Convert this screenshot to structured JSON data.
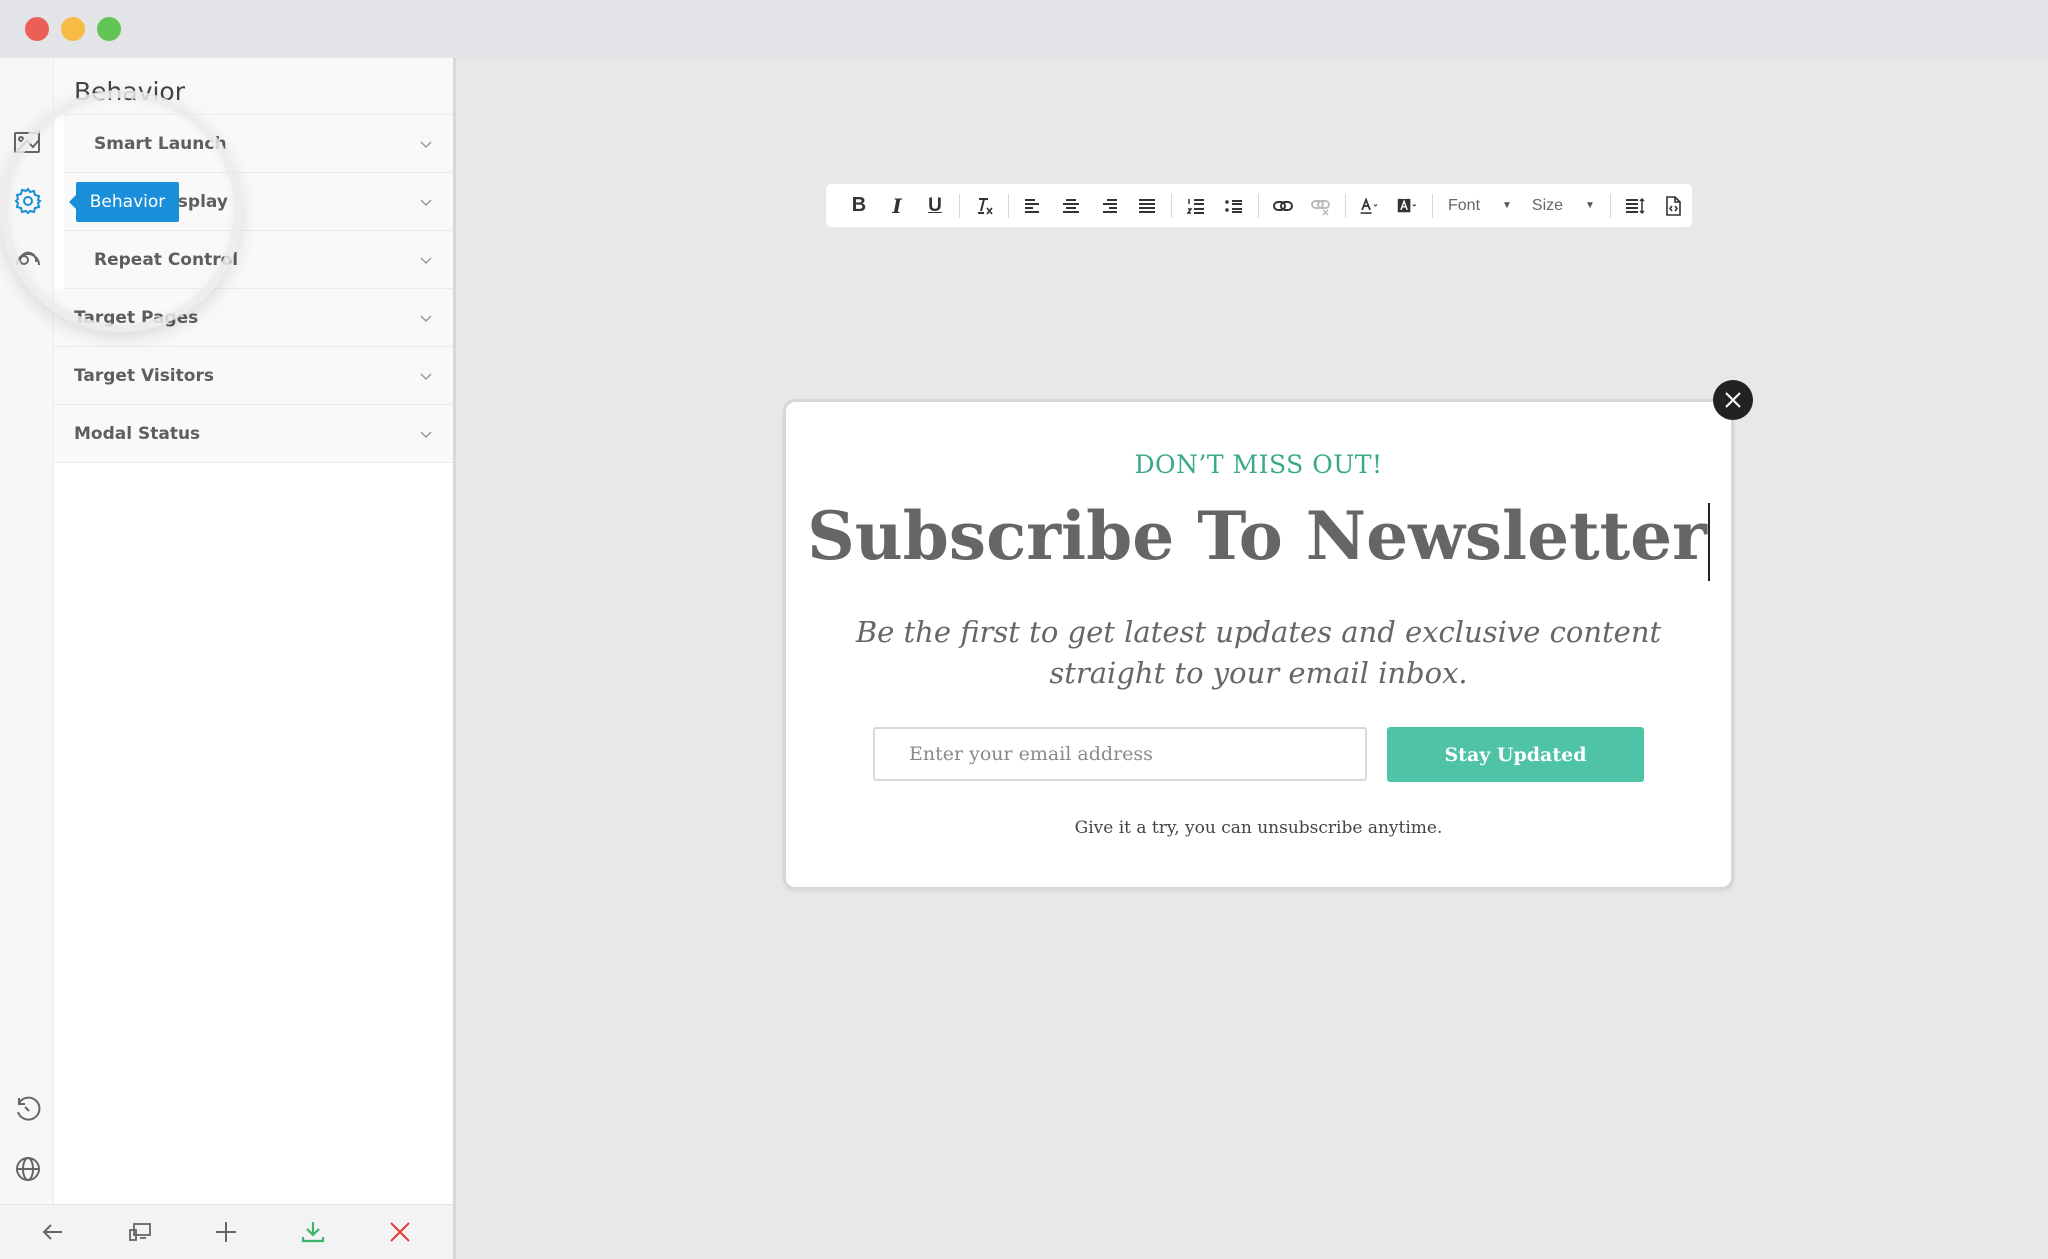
{
  "window": {
    "controls": [
      "close",
      "minimize",
      "maximize"
    ]
  },
  "rail": {
    "items": [
      {
        "icon": "image-icon",
        "label": "Design"
      },
      {
        "icon": "gear-icon",
        "label": "Behavior",
        "active": true
      },
      {
        "icon": "analytics-icon",
        "label": "Analytics"
      }
    ],
    "bottom_items": [
      {
        "icon": "history-icon"
      },
      {
        "icon": "globe-icon"
      }
    ],
    "tooltip": "Behavior",
    "accent_color": "#1a8fd9"
  },
  "panel": {
    "title": "Behavior",
    "sections": [
      {
        "label": "Smart Launch"
      },
      {
        "label": "Smart Display"
      },
      {
        "label": "Repeat Control"
      },
      {
        "label": "Target Pages"
      },
      {
        "label": "Target Visitors"
      },
      {
        "label": "Modal Status"
      }
    ],
    "visible_labels": {
      "smart_display_partial": "splay",
      "repeat_control_partial": "Repeat Contr"
    }
  },
  "bottom_bar": {
    "buttons": [
      {
        "icon": "arrow-left-icon",
        "label": "Back"
      },
      {
        "icon": "devices-icon",
        "label": "Preview"
      },
      {
        "icon": "plus-icon",
        "label": "Add"
      },
      {
        "icon": "download-icon",
        "label": "Save",
        "color": "#3bb56a"
      },
      {
        "icon": "close-icon",
        "label": "Close",
        "color": "#e0403a"
      }
    ]
  },
  "toolbar": {
    "buttons": [
      "bold",
      "italic",
      "underline",
      "clear-formatting",
      "align-left",
      "align-center",
      "align-right",
      "justify",
      "ordered-list",
      "unordered-list",
      "link",
      "unlink",
      "text-color",
      "background-color",
      "line-height",
      "source"
    ],
    "font_label": "Font",
    "size_label": "Size",
    "bold_glyph": "B",
    "italic_glyph": "I",
    "underline_glyph": "U"
  },
  "modal": {
    "eyebrow": "DON’T MISS OUT!",
    "title": "Subscribe To Newsletter",
    "subtitle": "Be the first to get latest updates and exclusive content straight to your email inbox.",
    "email_placeholder": "Enter your email address",
    "email_value": "",
    "button_label": "Stay Updated",
    "footnote": "Give it a try, you can unsubscribe anytime.",
    "accent_color": "#4fc3a5",
    "eyebrow_color": "#3aa88a"
  }
}
